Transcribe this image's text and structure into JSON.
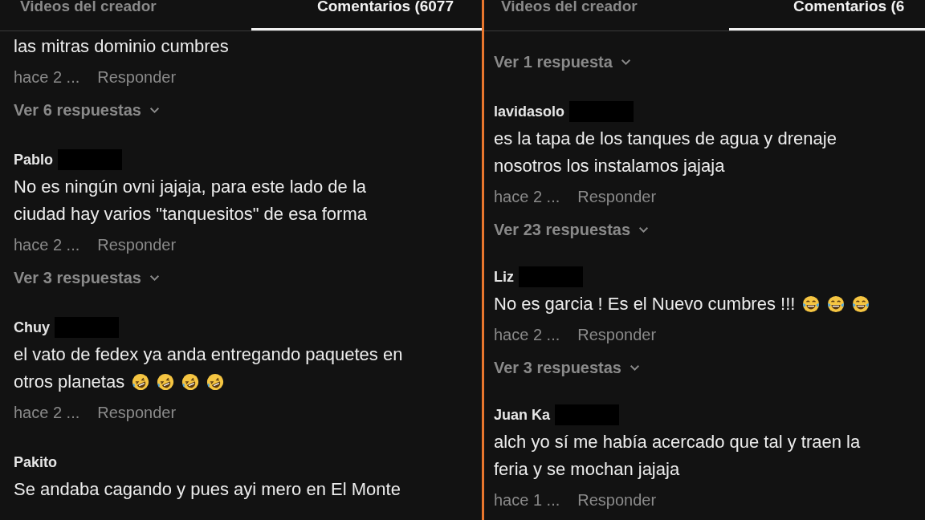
{
  "panels": [
    {
      "tabs": [
        {
          "label": "Videos del creador",
          "selected": false
        },
        {
          "label": "Comentarios (6077",
          "selected": true
        }
      ],
      "comments": [
        {
          "lines": [
            "las mitras dominio cumbres"
          ],
          "time": "hace 2 ...",
          "reply": "Responder",
          "replies": "Ver 6 respuestas"
        },
        {
          "author": "Pablo",
          "redacted": true,
          "lines": [
            "No es ningún ovni jajaja, para este lado de la",
            "ciudad hay varios \"tanquesitos\" de esa forma"
          ],
          "time": "hace 2 ...",
          "reply": "Responder",
          "replies": "Ver 3 respuestas"
        },
        {
          "author": "Chuy",
          "redacted": true,
          "lines": [
            "el vato de fedex ya anda entregando paquetes en",
            "otros planetas"
          ],
          "emojis": [
            {
              "kind": "rofl"
            },
            {
              "kind": "rofl"
            },
            {
              "kind": "rofl"
            },
            {
              "kind": "rofl"
            }
          ],
          "time": "hace 2 ...",
          "reply": "Responder"
        },
        {
          "author": "Pakito",
          "lines": [
            "Se andaba cagando y pues ayi mero en El Monte"
          ]
        }
      ]
    },
    {
      "tabs": [
        {
          "label": "Videos del creador",
          "selected": false
        },
        {
          "label": "Comentarios (6",
          "selected": true
        }
      ],
      "comments": [
        {
          "replies": "Ver 1 respuesta"
        },
        {
          "author": "lavidasolo",
          "redacted": true,
          "lines": [
            "es la tapa de los tanques de agua y drenaje",
            "nosotros los instalamos jajaja"
          ],
          "time": "hace 2 ...",
          "reply": "Responder",
          "replies": "Ver 23 respuestas"
        },
        {
          "author": "Liz",
          "redacted": true,
          "lines": [
            "No es garcia ! Es el Nuevo cumbres !!!"
          ],
          "emojis": [
            {
              "kind": "joy"
            },
            {
              "kind": "joy"
            },
            {
              "kind": "joy"
            }
          ],
          "time": "hace 2 ...",
          "reply": "Responder",
          "replies": "Ver 3 respuestas"
        },
        {
          "author": "Juan Ka",
          "redacted": true,
          "lines": [
            "alch yo sí me había acercado que tal y traen la",
            "feria y se mochan jajaja"
          ],
          "time": "hace 1 ...",
          "reply": "Responder"
        }
      ]
    }
  ]
}
